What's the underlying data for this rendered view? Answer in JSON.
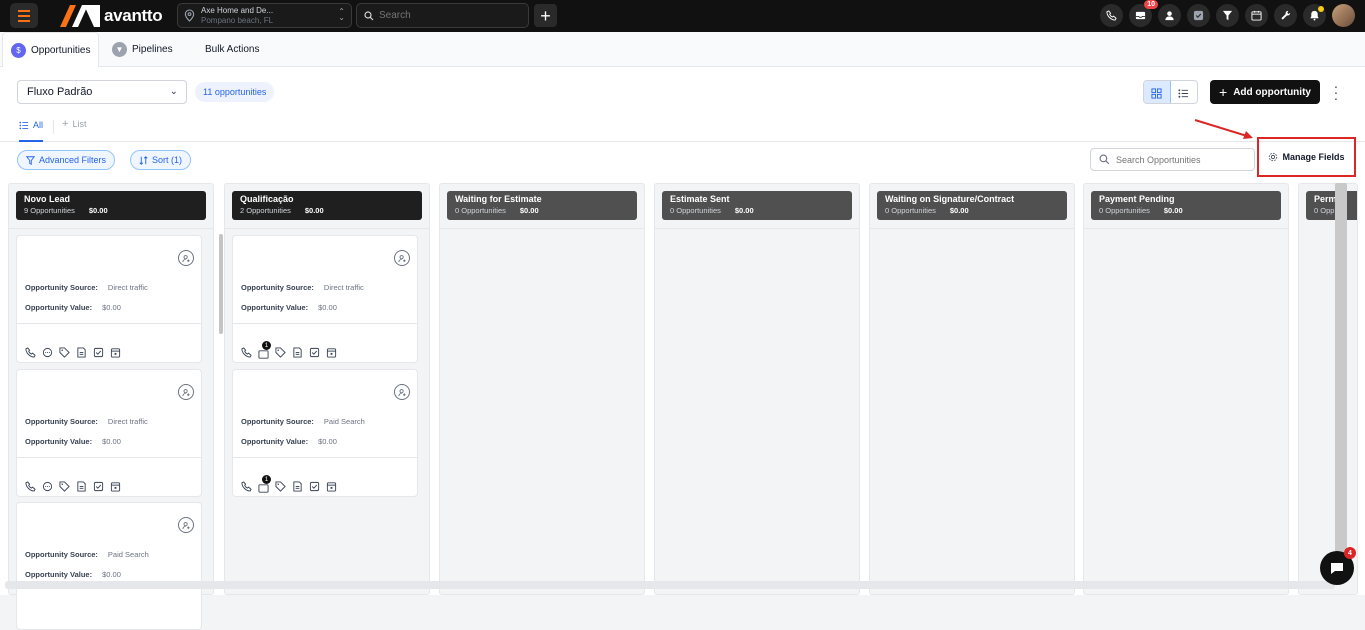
{
  "brand": {
    "name": "avantto",
    "accent": "#f97316"
  },
  "location": {
    "name": "Axe Home and De...",
    "city": "Pompano beach, FL"
  },
  "global_search": {
    "placeholder": "Search"
  },
  "notifications": {
    "inbox_count": "10"
  },
  "tabs": [
    {
      "label": "Opportunities",
      "active": true
    },
    {
      "label": "Pipelines",
      "active": false
    },
    {
      "label": "Bulk Actions",
      "active": false
    }
  ],
  "pipeline_select": {
    "value": "Fluxo Padrão"
  },
  "opportunity_count": "11 opportunities",
  "add_button": "Add opportunity",
  "subtabs": {
    "all": "All",
    "list": "List"
  },
  "filters": {
    "advanced": "Advanced Filters",
    "sort": "Sort (1)"
  },
  "search_opps": {
    "placeholder": "Search Opportunities"
  },
  "manage_fields": "Manage Fields",
  "columns": [
    {
      "title": "Novo Lead",
      "count": "9 Opportunities",
      "value": "$0.00"
    },
    {
      "title": "Qualificação",
      "count": "2 Opportunities",
      "value": "$0.00"
    },
    {
      "title": "Waiting for Estimate",
      "count": "0 Opportunities",
      "value": "$0.00"
    },
    {
      "title": "Estimate Sent",
      "count": "0 Opportunities",
      "value": "$0.00"
    },
    {
      "title": "Waiting on Signature/Contract",
      "count": "0 Opportunities",
      "value": "$0.00"
    },
    {
      "title": "Payment Pending",
      "count": "0 Opportunities",
      "value": "$0.00"
    },
    {
      "title": "Perm",
      "count": "0 Opp",
      "value": ""
    }
  ],
  "card_labels": {
    "source": "Opportunity Source:",
    "value": "Opportunity Value:"
  },
  "cards": {
    "col0": [
      {
        "source": "Direct traffic",
        "value": "$0.00"
      },
      {
        "source": "Direct traffic",
        "value": "$0.00"
      },
      {
        "source": "Paid Search",
        "value": "$0.00"
      }
    ],
    "col1": [
      {
        "source": "Direct traffic",
        "value": "$0.00",
        "badge": "1"
      },
      {
        "source": "Paid Search",
        "value": "$0.00",
        "badge": "1"
      }
    ]
  },
  "chat_badge": "4"
}
